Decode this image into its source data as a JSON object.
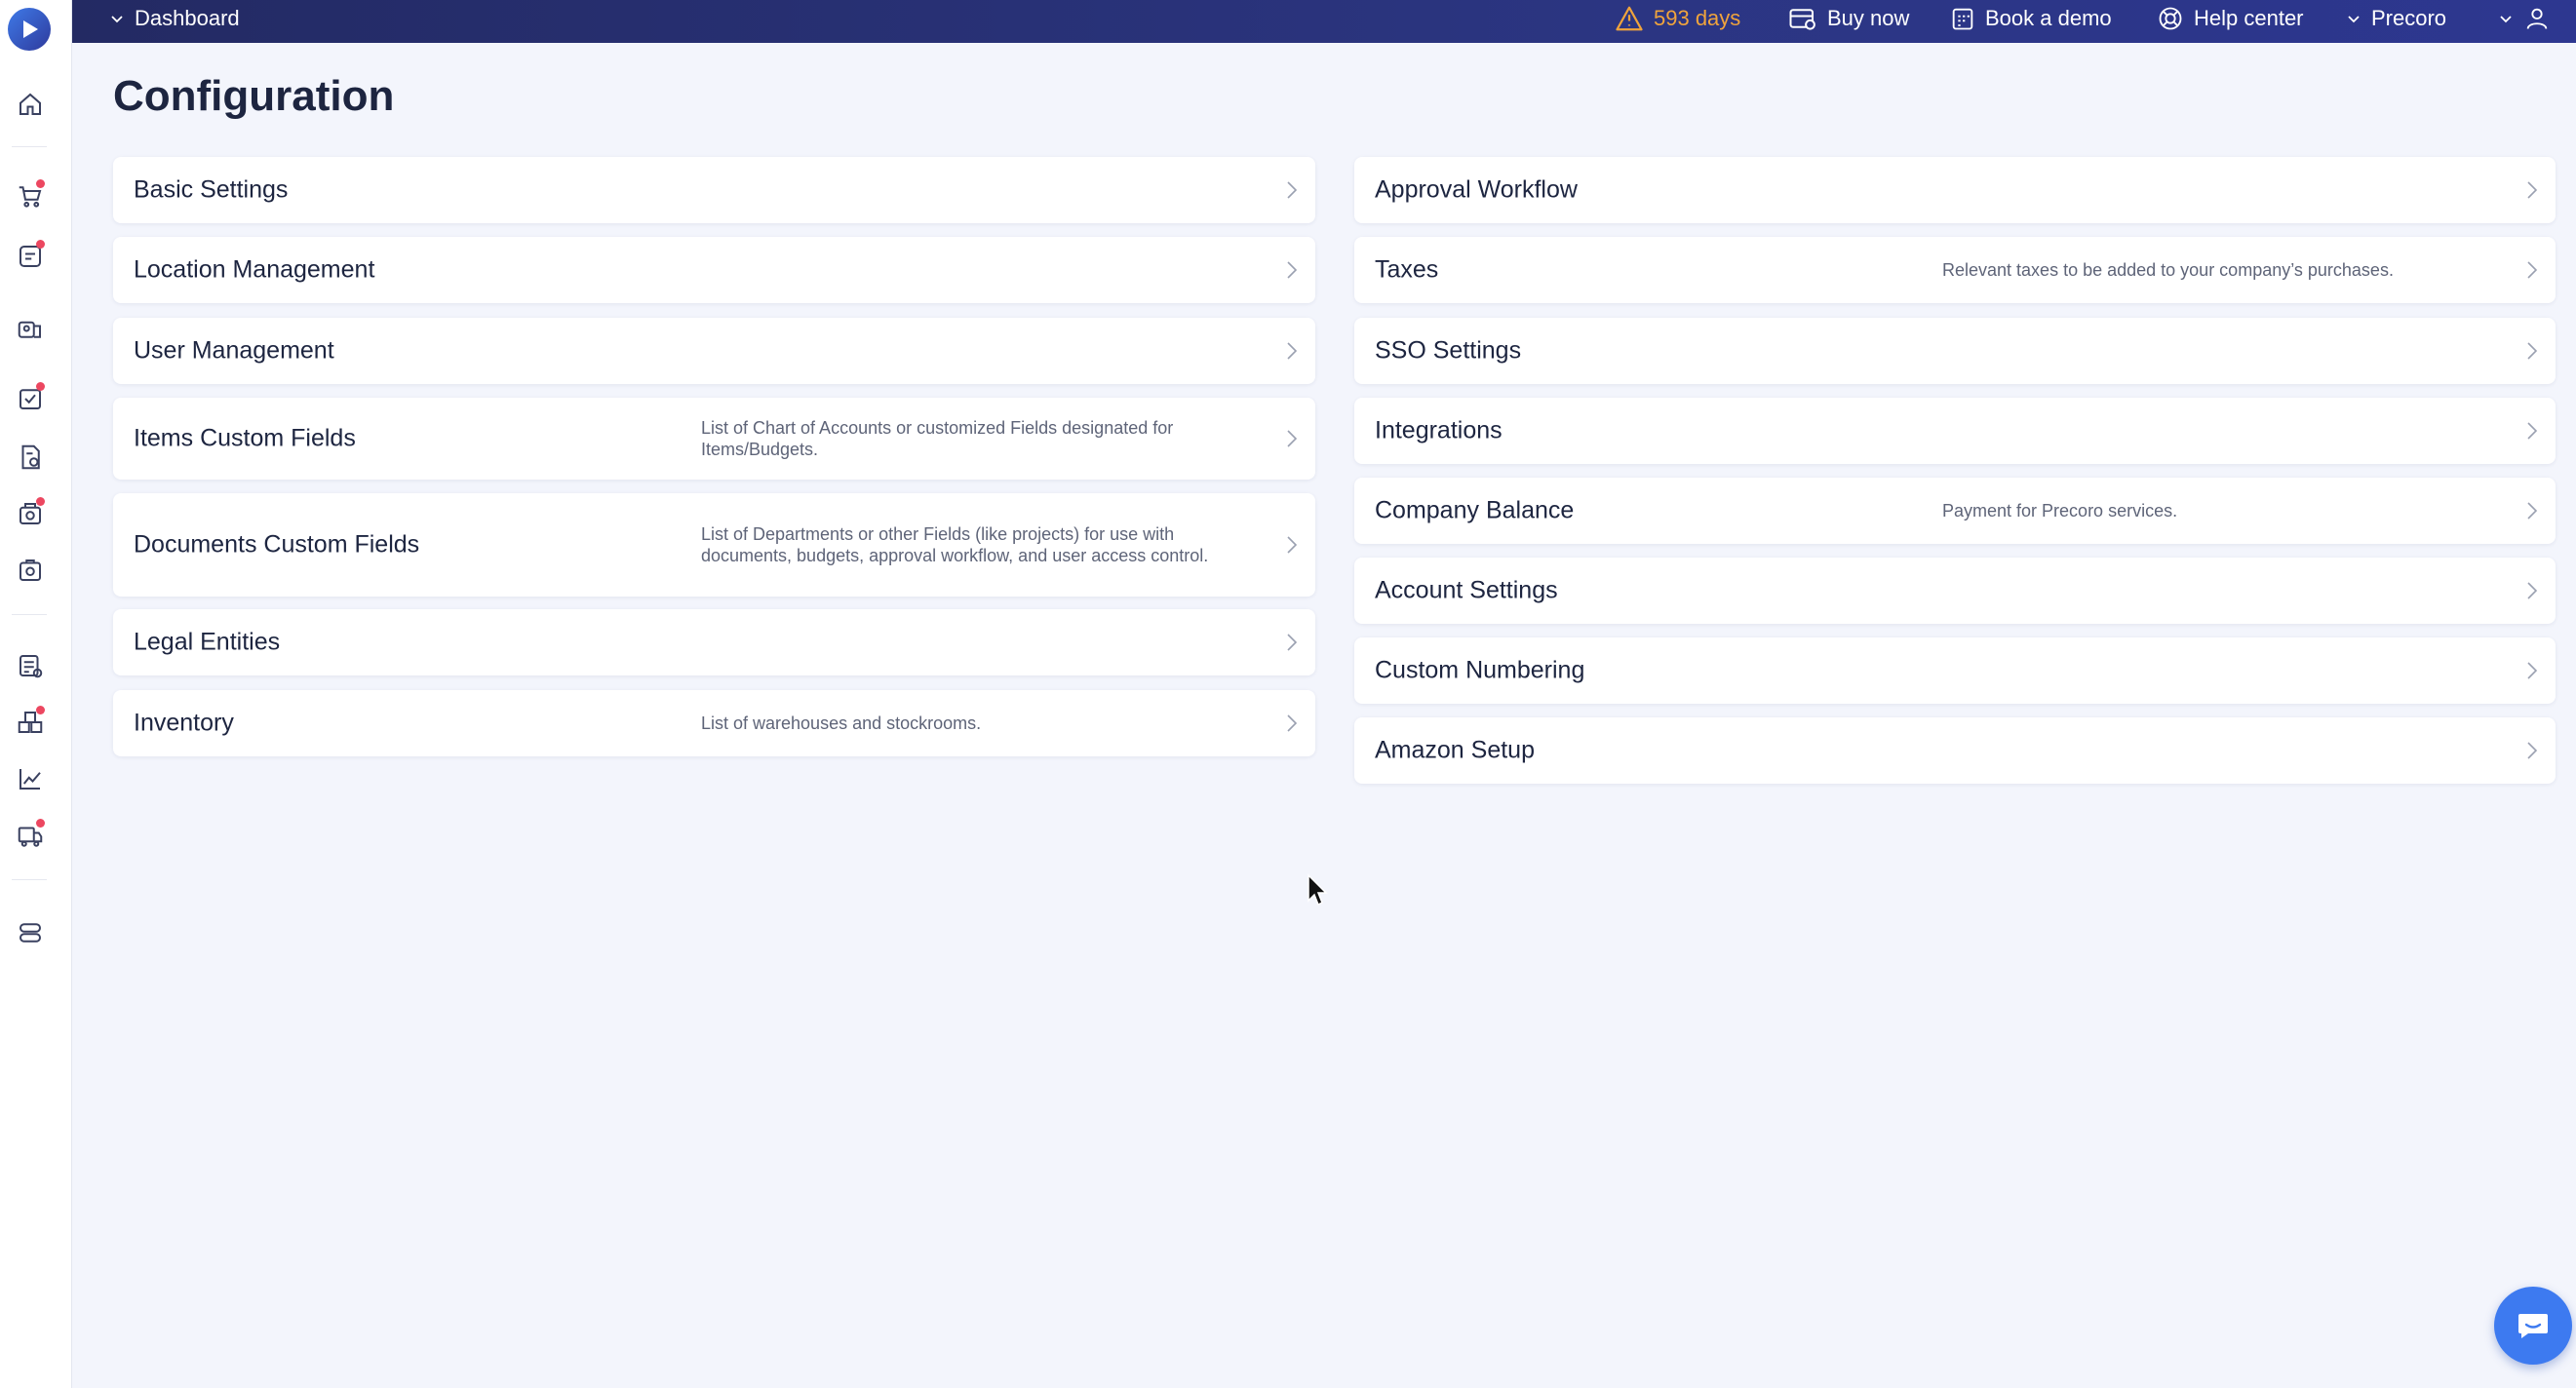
{
  "topbar": {
    "dashboard_label": "Dashboard",
    "trial_days": "593 days",
    "buy_now": "Buy now",
    "book_demo": "Book a demo",
    "help_center": "Help center",
    "company": "Precoro"
  },
  "page": {
    "title": "Configuration"
  },
  "left_cards": [
    {
      "title": "Basic Settings",
      "desc": ""
    },
    {
      "title": "Location Management",
      "desc": ""
    },
    {
      "title": "User Management",
      "desc": ""
    },
    {
      "title": "Items Custom Fields",
      "desc": "List of Chart of Accounts or customized Fields designated for Items/Budgets."
    },
    {
      "title": "Documents Custom Fields",
      "desc": "List of Departments or other Fields (like projects) for use with documents, budgets, approval workflow, and user access control."
    },
    {
      "title": "Legal Entities",
      "desc": ""
    },
    {
      "title": "Inventory",
      "desc": "List of warehouses and stockrooms."
    }
  ],
  "right_cards": [
    {
      "title": "Approval Workflow",
      "desc": ""
    },
    {
      "title": "Taxes",
      "desc": "Relevant taxes to be added to your company’s purchases."
    },
    {
      "title": "SSO Settings",
      "desc": ""
    },
    {
      "title": "Integrations",
      "desc": ""
    },
    {
      "title": "Company Balance",
      "desc": "Payment for Precoro services."
    },
    {
      "title": "Account Settings",
      "desc": ""
    },
    {
      "title": "Custom Numbering",
      "desc": ""
    },
    {
      "title": "Amazon Setup",
      "desc": ""
    }
  ],
  "sidebar_icons": [
    "home-icon",
    "cart-icon",
    "requests-icon",
    "suppliers-icon",
    "approvals-icon",
    "invoices-icon",
    "payments-icon",
    "receipts-icon",
    "budgets-icon",
    "catalog-icon",
    "analytics-icon",
    "delivery-icon",
    "settings-icon"
  ],
  "colors": {
    "topbar": "#2b3581",
    "accent": "#3d7af0",
    "warning": "#f0a43c",
    "notification_dot": "#ec4760"
  }
}
